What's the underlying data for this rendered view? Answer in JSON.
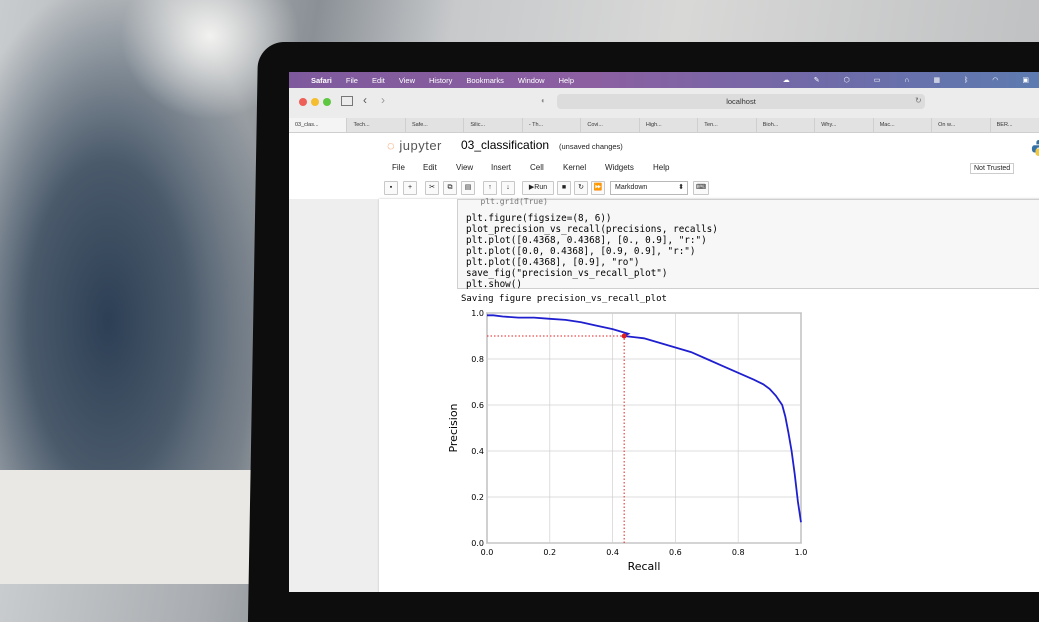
{
  "macos_menubar": {
    "items": [
      "Safari",
      "File",
      "Edit",
      "View",
      "History",
      "Bookmarks",
      "Window",
      "Help"
    ]
  },
  "browser": {
    "url": "localhost",
    "tabs": [
      "03_clas...",
      "Tech...",
      "Safe...",
      "Silic...",
      "- Th...",
      "Covi...",
      "High...",
      "Ten...",
      "Bioh...",
      "Why...",
      "Mac...",
      "On w...",
      "BER..."
    ]
  },
  "jupyter": {
    "logo_text": "jupyter",
    "notebook_name": "03_classification",
    "status": "(unsaved changes)",
    "menu": [
      "File",
      "Edit",
      "View",
      "Insert",
      "Cell",
      "Kernel",
      "Widgets",
      "Help"
    ],
    "trusted": "Not Trusted",
    "run_label": "Run",
    "cell_type": "Markdown"
  },
  "cell": {
    "code_lines": [
      "plt.figure(figsize=(8, 6))",
      "plot_precision_vs_recall(precisions, recalls)",
      "plt.plot([0.4368, 0.4368], [0., 0.9], \"r:\")",
      "plt.plot([0.0, 0.4368], [0.9, 0.9], \"r:\")",
      "plt.plot([0.4368], [0.9], \"ro\")",
      "save_fig(\"precision_vs_recall_plot\")",
      "plt.show()"
    ],
    "output_text": "Saving figure precision_vs_recall_plot"
  },
  "chart_data": {
    "type": "line",
    "xlabel": "Recall",
    "ylabel": "Precision",
    "xlim": [
      0.0,
      1.0
    ],
    "ylim": [
      0.0,
      1.0
    ],
    "xticks": [
      "0.0",
      "0.2",
      "0.4",
      "0.6",
      "0.8",
      "1.0"
    ],
    "yticks": [
      "0.0",
      "0.2",
      "0.4",
      "0.6",
      "0.8",
      "1.0"
    ],
    "grid": true,
    "series": [
      {
        "color": "#1f1fd0",
        "x": [
          0.0,
          0.02,
          0.05,
          0.1,
          0.15,
          0.2,
          0.25,
          0.3,
          0.35,
          0.4,
          0.45,
          0.4368,
          0.5,
          0.55,
          0.6,
          0.65,
          0.7,
          0.75,
          0.8,
          0.85,
          0.88,
          0.9,
          0.92,
          0.94,
          0.95,
          0.96,
          0.97,
          0.98,
          0.99,
          1.0
        ],
        "y": [
          0.99,
          0.99,
          0.985,
          0.98,
          0.98,
          0.975,
          0.97,
          0.96,
          0.945,
          0.93,
          0.91,
          0.9,
          0.89,
          0.87,
          0.85,
          0.83,
          0.8,
          0.77,
          0.74,
          0.71,
          0.69,
          0.67,
          0.64,
          0.6,
          0.55,
          0.48,
          0.4,
          0.3,
          0.18,
          0.09
        ]
      }
    ],
    "threshold_point": {
      "x": 0.4368,
      "y": 0.9,
      "color": "#e02020"
    }
  }
}
